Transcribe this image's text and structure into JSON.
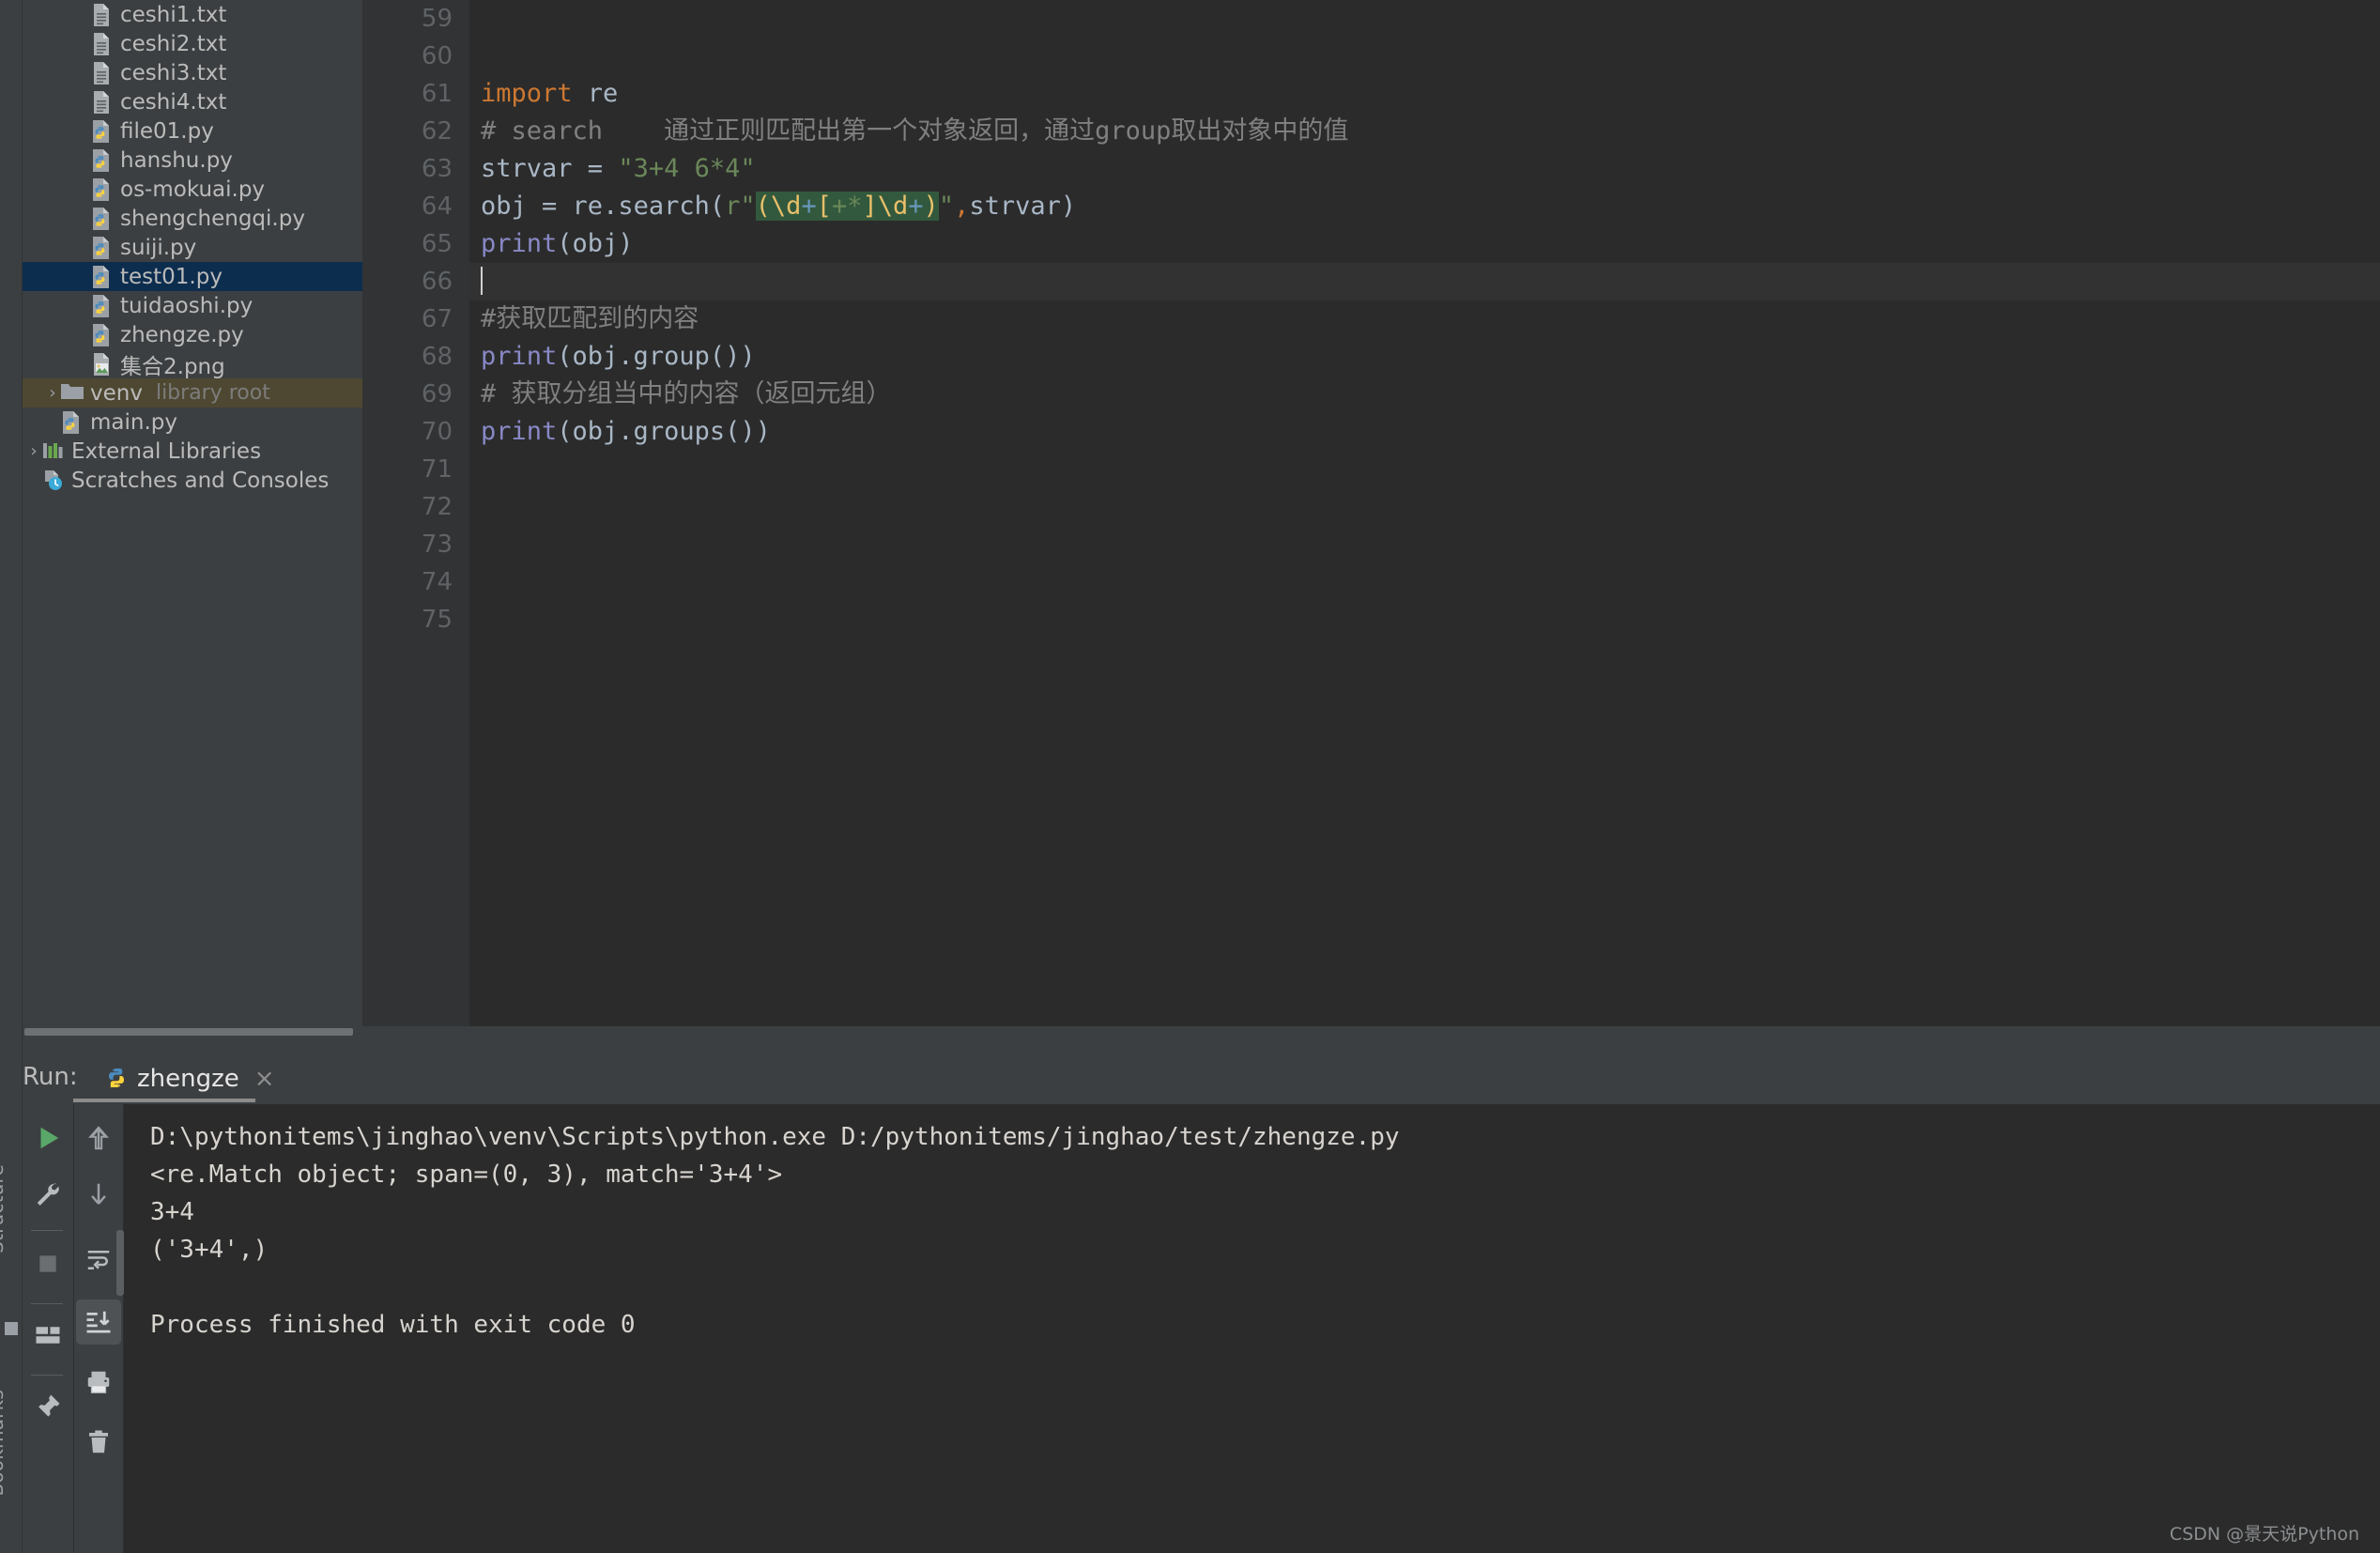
{
  "ide": {
    "name": "PyCharm",
    "colors": {
      "panel_bg": "#3c3f41",
      "editor_bg": "#2b2b2b",
      "gutter_bg": "#313335",
      "current_line": "#323232",
      "selection_blue": "#0d2d4e",
      "venv_highlight": "#4e4832",
      "keyword_orange": "#cc7832",
      "string_green": "#6a8759",
      "comment_gray": "#808080",
      "function_purple": "#8888c6",
      "number_blue": "#6897bb",
      "regex_group_yellow": "#e8bf6a",
      "regex_highlight_bg": "#32593d",
      "run_green": "#59a869",
      "text_primary": "#bbbbbb",
      "console_text": "#d8d4cf"
    }
  },
  "left_strip": {
    "labels": [
      "Structure",
      "Bookmarks"
    ]
  },
  "project_tree": {
    "items": [
      {
        "label": "ceshi1.txt",
        "icon": "text-file-icon",
        "indent": 2,
        "arrow": "",
        "state": "normal",
        "sublabel": ""
      },
      {
        "label": "ceshi2.txt",
        "icon": "text-file-icon",
        "indent": 2,
        "arrow": "",
        "state": "normal",
        "sublabel": ""
      },
      {
        "label": "ceshi3.txt",
        "icon": "text-file-icon",
        "indent": 2,
        "arrow": "",
        "state": "normal",
        "sublabel": ""
      },
      {
        "label": "ceshi4.txt",
        "icon": "text-file-icon",
        "indent": 2,
        "arrow": "",
        "state": "normal",
        "sublabel": ""
      },
      {
        "label": "file01.py",
        "icon": "python-file-icon",
        "indent": 2,
        "arrow": "",
        "state": "normal",
        "sublabel": ""
      },
      {
        "label": "hanshu.py",
        "icon": "python-file-icon",
        "indent": 2,
        "arrow": "",
        "state": "normal",
        "sublabel": ""
      },
      {
        "label": "os-mokuai.py",
        "icon": "python-file-icon",
        "indent": 2,
        "arrow": "",
        "state": "normal",
        "sublabel": ""
      },
      {
        "label": "shengchengqi.py",
        "icon": "python-file-icon",
        "indent": 2,
        "arrow": "",
        "state": "normal",
        "sublabel": ""
      },
      {
        "label": "suiji.py",
        "icon": "python-file-icon",
        "indent": 2,
        "arrow": "",
        "state": "normal",
        "sublabel": ""
      },
      {
        "label": "test01.py",
        "icon": "python-file-icon",
        "indent": 2,
        "arrow": "",
        "state": "selected",
        "sublabel": ""
      },
      {
        "label": "tuidaoshi.py",
        "icon": "python-file-icon",
        "indent": 2,
        "arrow": "",
        "state": "normal",
        "sublabel": ""
      },
      {
        "label": "zhengze.py",
        "icon": "python-file-icon",
        "indent": 2,
        "arrow": "",
        "state": "normal",
        "sublabel": ""
      },
      {
        "label": "集合2.png",
        "icon": "image-file-icon",
        "indent": 2,
        "arrow": "",
        "state": "normal",
        "sublabel": ""
      },
      {
        "label": "venv",
        "icon": "folder-icon",
        "indent": 1,
        "arrow": "›",
        "state": "venv",
        "sublabel": "library root"
      },
      {
        "label": "main.py",
        "icon": "python-file-icon",
        "indent": 1,
        "arrow": "",
        "state": "normal",
        "sublabel": ""
      },
      {
        "label": "External Libraries",
        "icon": "libraries-icon",
        "indent": 0,
        "arrow": "›",
        "state": "normal",
        "sublabel": ""
      },
      {
        "label": "Scratches and Consoles",
        "icon": "scratches-icon",
        "indent": 0,
        "arrow": "",
        "state": "normal",
        "sublabel": ""
      }
    ]
  },
  "editor": {
    "first_visible_line": 59,
    "cursor_line": 66,
    "lines": [
      {
        "n": 59,
        "segments": []
      },
      {
        "n": 60,
        "segments": []
      },
      {
        "n": 61,
        "segments": [
          {
            "t": "import ",
            "c": "kw"
          },
          {
            "t": "re",
            "c": "def"
          }
        ]
      },
      {
        "n": 62,
        "segments": [
          {
            "t": "# search    通过正则匹配出第一个对象返回，通过group取出对象中的值",
            "c": "cmt"
          }
        ]
      },
      {
        "n": 63,
        "segments": [
          {
            "t": "strvar ",
            "c": "def"
          },
          {
            "t": "= ",
            "c": "def"
          },
          {
            "t": "\"3+4 6*4\"",
            "c": "str"
          }
        ]
      },
      {
        "n": 64,
        "segments": [
          {
            "t": "obj ",
            "c": "def"
          },
          {
            "t": "= ",
            "c": "def"
          },
          {
            "t": "re",
            "c": "def"
          },
          {
            "t": ".",
            "c": "def"
          },
          {
            "t": "search",
            "c": "def"
          },
          {
            "t": "(",
            "c": "def"
          },
          {
            "t": "r\"",
            "c": "str"
          },
          {
            "t": "(\\d+[+*]\\d+)",
            "c": "regex"
          },
          {
            "t": "\"",
            "c": "str"
          },
          {
            "t": ",",
            "c": "comma"
          },
          {
            "t": "strvar",
            "c": "def"
          },
          {
            "t": ")",
            "c": "def"
          }
        ]
      },
      {
        "n": 65,
        "segments": [
          {
            "t": "print",
            "c": "fn"
          },
          {
            "t": "(obj)",
            "c": "def"
          }
        ]
      },
      {
        "n": 66,
        "segments": [],
        "cursor": true
      },
      {
        "n": 67,
        "segments": [
          {
            "t": "#获取匹配到的内容",
            "c": "cmt"
          }
        ]
      },
      {
        "n": 68,
        "segments": [
          {
            "t": "print",
            "c": "fn"
          },
          {
            "t": "(obj.group())",
            "c": "def"
          }
        ]
      },
      {
        "n": 69,
        "segments": [
          {
            "t": "# 获取分组当中的内容（返回元组）",
            "c": "cmt"
          }
        ]
      },
      {
        "n": 70,
        "segments": [
          {
            "t": "print",
            "c": "fn"
          },
          {
            "t": "(obj.groups())",
            "c": "def"
          }
        ]
      },
      {
        "n": 71,
        "segments": []
      },
      {
        "n": 72,
        "segments": []
      },
      {
        "n": 73,
        "segments": []
      },
      {
        "n": 74,
        "segments": []
      },
      {
        "n": 75,
        "segments": []
      }
    ],
    "regex_tokens": [
      {
        "t": "(",
        "c": "re-par"
      },
      {
        "t": "\\d",
        "c": "re-esc"
      },
      {
        "t": "+",
        "c": "re-meta"
      },
      {
        "t": "[",
        "c": "re-cls"
      },
      {
        "t": "+",
        "c": "re-star"
      },
      {
        "t": "*",
        "c": "re-star"
      },
      {
        "t": "]",
        "c": "re-cls"
      },
      {
        "t": "\\d",
        "c": "re-esc"
      },
      {
        "t": "+",
        "c": "re-meta"
      },
      {
        "t": ")",
        "c": "re-par"
      }
    ]
  },
  "run_panel": {
    "title": "Run:",
    "tab": {
      "label": "zhengze",
      "icon": "python-file-icon",
      "close": "×"
    },
    "toolbar_left": [
      {
        "name": "rerun-button",
        "icon": "play-icon"
      },
      {
        "name": "settings-button",
        "icon": "wrench-icon"
      },
      {
        "name": "stop-button",
        "icon": "stop-square-icon"
      },
      {
        "name": "layout-button",
        "icon": "layout-icon"
      },
      {
        "name": "pin-tab-button",
        "icon": "pin-icon"
      }
    ],
    "toolbar_right": [
      {
        "name": "up-the-stack-button",
        "icon": "arrow-up-icon"
      },
      {
        "name": "down-the-stack-button",
        "icon": "arrow-down-icon"
      },
      {
        "name": "soft-wrap-button",
        "icon": "soft-wrap-icon"
      },
      {
        "name": "scroll-to-end-button",
        "icon": "scroll-to-end-icon",
        "active": true
      },
      {
        "name": "print-button",
        "icon": "printer-icon"
      },
      {
        "name": "clear-all-button",
        "icon": "trash-icon"
      }
    ],
    "console_lines": [
      "D:\\pythonitems\\jinghao\\venv\\Scripts\\python.exe D:/pythonitems/jinghao/test/zhengze.py",
      "<re.Match object; span=(0, 3), match='3+4'>",
      "3+4",
      "('3+4',)",
      "",
      "Process finished with exit code 0"
    ]
  },
  "watermark": {
    "text": "CSDN @景天说Python"
  }
}
